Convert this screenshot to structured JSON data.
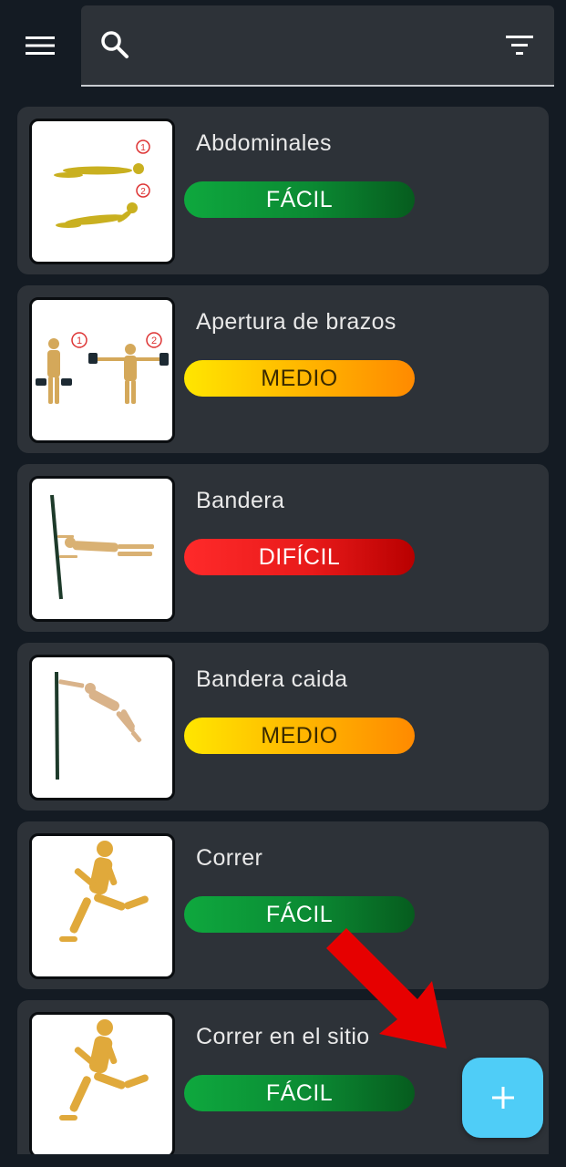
{
  "toolbar": {
    "menu_icon": "menu-icon",
    "search_icon": "search-icon",
    "search_value": "",
    "search_placeholder": "",
    "filter_icon": "filter-icon"
  },
  "exercises": [
    {
      "name": "Abdominales",
      "difficulty": "FÁCIL",
      "level": "easy",
      "image": "abdominales-figure"
    },
    {
      "name": "Apertura de brazos",
      "difficulty": "MEDIO",
      "level": "medium",
      "image": "apertura-de-brazos-figure"
    },
    {
      "name": "Bandera",
      "difficulty": "DIFÍCIL",
      "level": "hard",
      "image": "bandera-figure"
    },
    {
      "name": "Bandera caida",
      "difficulty": "MEDIO",
      "level": "medium",
      "image": "bandera-caida-figure"
    },
    {
      "name": "Correr",
      "difficulty": "FÁCIL",
      "level": "easy",
      "image": "correr-figure"
    },
    {
      "name": "Correr en el sitio",
      "difficulty": "FÁCIL",
      "level": "easy",
      "image": "correr-en-el-sitio-figure"
    }
  ],
  "fab": {
    "icon": "plus-icon"
  },
  "colors": {
    "background": "#141b23",
    "card": "#2d3238",
    "easy": "#0b8a33",
    "medium": "#ffb300",
    "hard": "#e81a1a",
    "fab": "#4fcdf7",
    "annotation_arrow": "#e60000"
  }
}
